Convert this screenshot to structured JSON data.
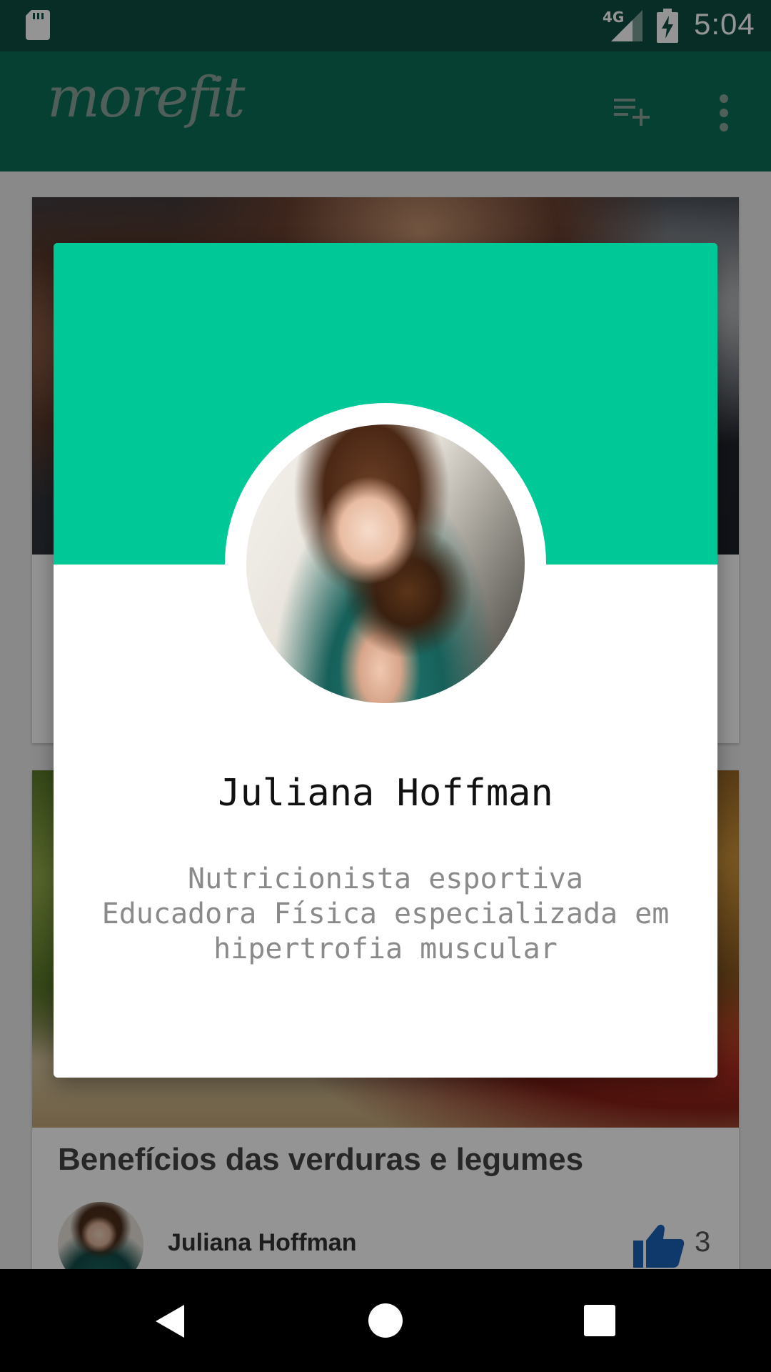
{
  "status_bar": {
    "network_type": "4G",
    "time": "5:04",
    "icons": [
      "sd-card-icon",
      "signal-icon",
      "battery-charging-icon"
    ]
  },
  "app_bar": {
    "logo_text": "morefit",
    "actions": [
      "playlist-add-icon",
      "overflow-menu-icon"
    ]
  },
  "feed": {
    "cards": [
      {
        "title": "",
        "image": "fitness-couple-photo"
      },
      {
        "title": "Benefícios das verduras e legumes",
        "image": "vegetables-photo",
        "author": "Juliana Hoffman",
        "likes": "3"
      }
    ]
  },
  "profile_dialog": {
    "name": "Juliana Hoffman",
    "bio_lines": [
      "Nutricionista esportiva",
      "Educadora Física especializada em",
      "hipertrofia muscular"
    ],
    "header_color": "#00c896"
  },
  "nav_bar": {
    "buttons": [
      "back-icon",
      "home-icon",
      "recents-icon"
    ]
  },
  "colors": {
    "status_bar": "#0f4f43",
    "app_bar": "#0b6e56",
    "accent": "#00c896",
    "like_blue": "#1d63b8"
  }
}
